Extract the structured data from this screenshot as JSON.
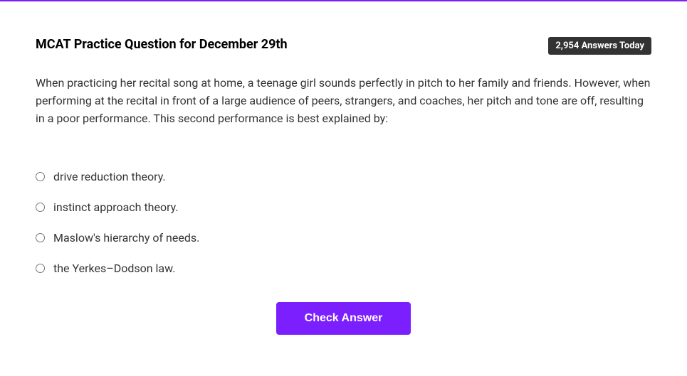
{
  "header": {
    "title": "MCAT Practice Question for December 29th",
    "badge": "2,954 Answers Today"
  },
  "question": {
    "text": "When practicing her recital song at home, a teenage girl sounds perfectly in pitch to her family and friends. However, when performing at the recital in front of a large audience of peers, strangers, and coaches, her pitch and tone are off, resulting in a poor performance. This second performance is best explained by:"
  },
  "options": [
    {
      "label": "drive reduction theory."
    },
    {
      "label": "instinct approach theory."
    },
    {
      "label": "Maslow's hierarchy of needs."
    },
    {
      "label": "the Yerkes–Dodson law."
    }
  ],
  "button": {
    "check_label": "Check Answer"
  }
}
